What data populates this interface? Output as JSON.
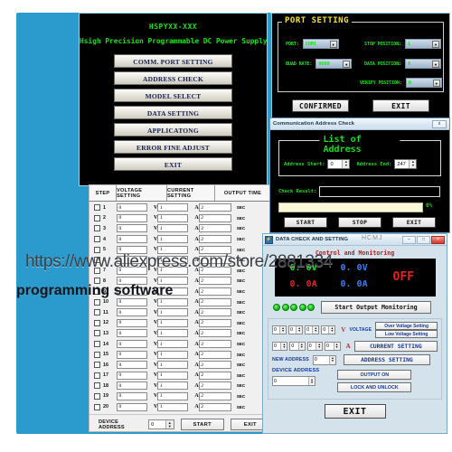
{
  "watermark": {
    "url": "https://www.aliexpress.com/store/2881334",
    "caption": "programming software",
    "corner": "HCMJ"
  },
  "main_menu": {
    "title": "HSPYXX-XXX",
    "subtitle": "Hsigh Precision Programmable DC Power Supply",
    "buttons": [
      "COMM. PORT SETTING",
      "ADDRESS CHECK",
      "MODEL   SELECT",
      "DATA   SETTING",
      "APPLICATONG",
      "ERROR FINE ADJUST",
      "EXIT"
    ]
  },
  "port_setting": {
    "legend": "PORT SETTING",
    "fields": [
      {
        "label": "PORT:",
        "value": "COM1"
      },
      {
        "label": "BUAD RATE:",
        "value": "9600"
      },
      {
        "label": "STOP POSITION:",
        "value": "1"
      },
      {
        "label": "DATA POSITION:",
        "value": "8"
      },
      {
        "label": "VERIFY POSITION:",
        "value": "N"
      }
    ],
    "confirm_label": "CONFIRMED",
    "exit_label": "EXIT"
  },
  "address_check": {
    "window_title": "Communication Address Check",
    "close_label": "x",
    "legend": "List of Address",
    "start_label": "Address Start:",
    "start_value": "0",
    "end_label": "Address End:",
    "end_value": "247",
    "result_label": "Check Result:",
    "result_value": "",
    "progress_text": "0%",
    "progress_percent": 0,
    "buttons": [
      "START",
      "STOP",
      "EXIT"
    ]
  },
  "data_check": {
    "window_title": "DATA CHECK AND SETTING",
    "minimize_label": "–",
    "maximize_label": "□",
    "close_label": "×",
    "header": "Control and Monitoring",
    "lcd": {
      "voltage_set": "0. 0V",
      "voltage_read": "0. 0V",
      "current_set": "0. 0A",
      "current_read": "0. 0A",
      "output_state": "OFF"
    },
    "led_count": 5,
    "monitor_button": "Start Output Monitoring",
    "voltage_digits": [
      "0",
      "0",
      "0",
      "0"
    ],
    "voltage_unit": "V",
    "voltage_label": "VOLTAGE",
    "over_voltage_label": "Over Voltage Setting",
    "low_voltage_label": "Low Voltage Setting",
    "current_digits": [
      "0",
      "0",
      "0",
      "0"
    ],
    "current_unit": "A",
    "current_button": "CURRENT SETTING",
    "new_address_label": "NEW ADDRESS",
    "new_address_value": "0",
    "address_button": "ADDRESS SETTING",
    "device_address_label": "DEVICE ADDRESS",
    "device_address_value": "0",
    "output_on_label": "OUTPUT ON",
    "lock_label": "LOCK AND UNLOCK",
    "exit_label": "EXIT"
  },
  "step_table": {
    "headers": [
      "STEP",
      "VOLTAGE SETTING",
      "CURRENT SETTING",
      "OUTPUT TIME"
    ],
    "units": {
      "voltage": "V",
      "current": "A",
      "time": "SEC"
    },
    "rows": [
      {
        "step": "1",
        "voltage": "0",
        "current": "1",
        "time": "2"
      },
      {
        "step": "2",
        "voltage": "0",
        "current": "1",
        "time": "2"
      },
      {
        "step": "3",
        "voltage": "0",
        "current": "1",
        "time": "2"
      },
      {
        "step": "4",
        "voltage": "0",
        "current": "1",
        "time": "2"
      },
      {
        "step": "5",
        "voltage": "0",
        "current": "1",
        "time": "2"
      },
      {
        "step": "6",
        "voltage": "0",
        "current": "1",
        "time": "2"
      },
      {
        "step": "7",
        "voltage": "0",
        "current": "1",
        "time": "2"
      },
      {
        "step": "8",
        "voltage": "0",
        "current": "1",
        "time": "2"
      },
      {
        "step": "9",
        "voltage": "0",
        "current": "1",
        "time": "2"
      },
      {
        "step": "10",
        "voltage": "0",
        "current": "1",
        "time": "2"
      },
      {
        "step": "11",
        "voltage": "0",
        "current": "1",
        "time": "2"
      },
      {
        "step": "12",
        "voltage": "0",
        "current": "1",
        "time": "2"
      },
      {
        "step": "13",
        "voltage": "0",
        "current": "1",
        "time": "2"
      },
      {
        "step": "14",
        "voltage": "0",
        "current": "1",
        "time": "2"
      },
      {
        "step": "15",
        "voltage": "0",
        "current": "1",
        "time": "2"
      },
      {
        "step": "16",
        "voltage": "0",
        "current": "1",
        "time": "2"
      },
      {
        "step": "17",
        "voltage": "0",
        "current": "1",
        "time": "2"
      },
      {
        "step": "18",
        "voltage": "0",
        "current": "1",
        "time": "2"
      },
      {
        "step": "19",
        "voltage": "0",
        "current": "1",
        "time": "2"
      },
      {
        "step": "20",
        "voltage": "0",
        "current": "1",
        "time": "2"
      }
    ],
    "footer": {
      "device_address_label": "DEVICE ADDRESS",
      "device_address_value": "0",
      "start_label": "START",
      "exit_label": "EXIT"
    }
  },
  "colors": {
    "backdrop_blue": "#2b9bce",
    "terminal_green": "#18e018",
    "legend_yellow": "#f2e23a",
    "alert_red": "#cc1414",
    "accent_blue": "#14379c"
  }
}
